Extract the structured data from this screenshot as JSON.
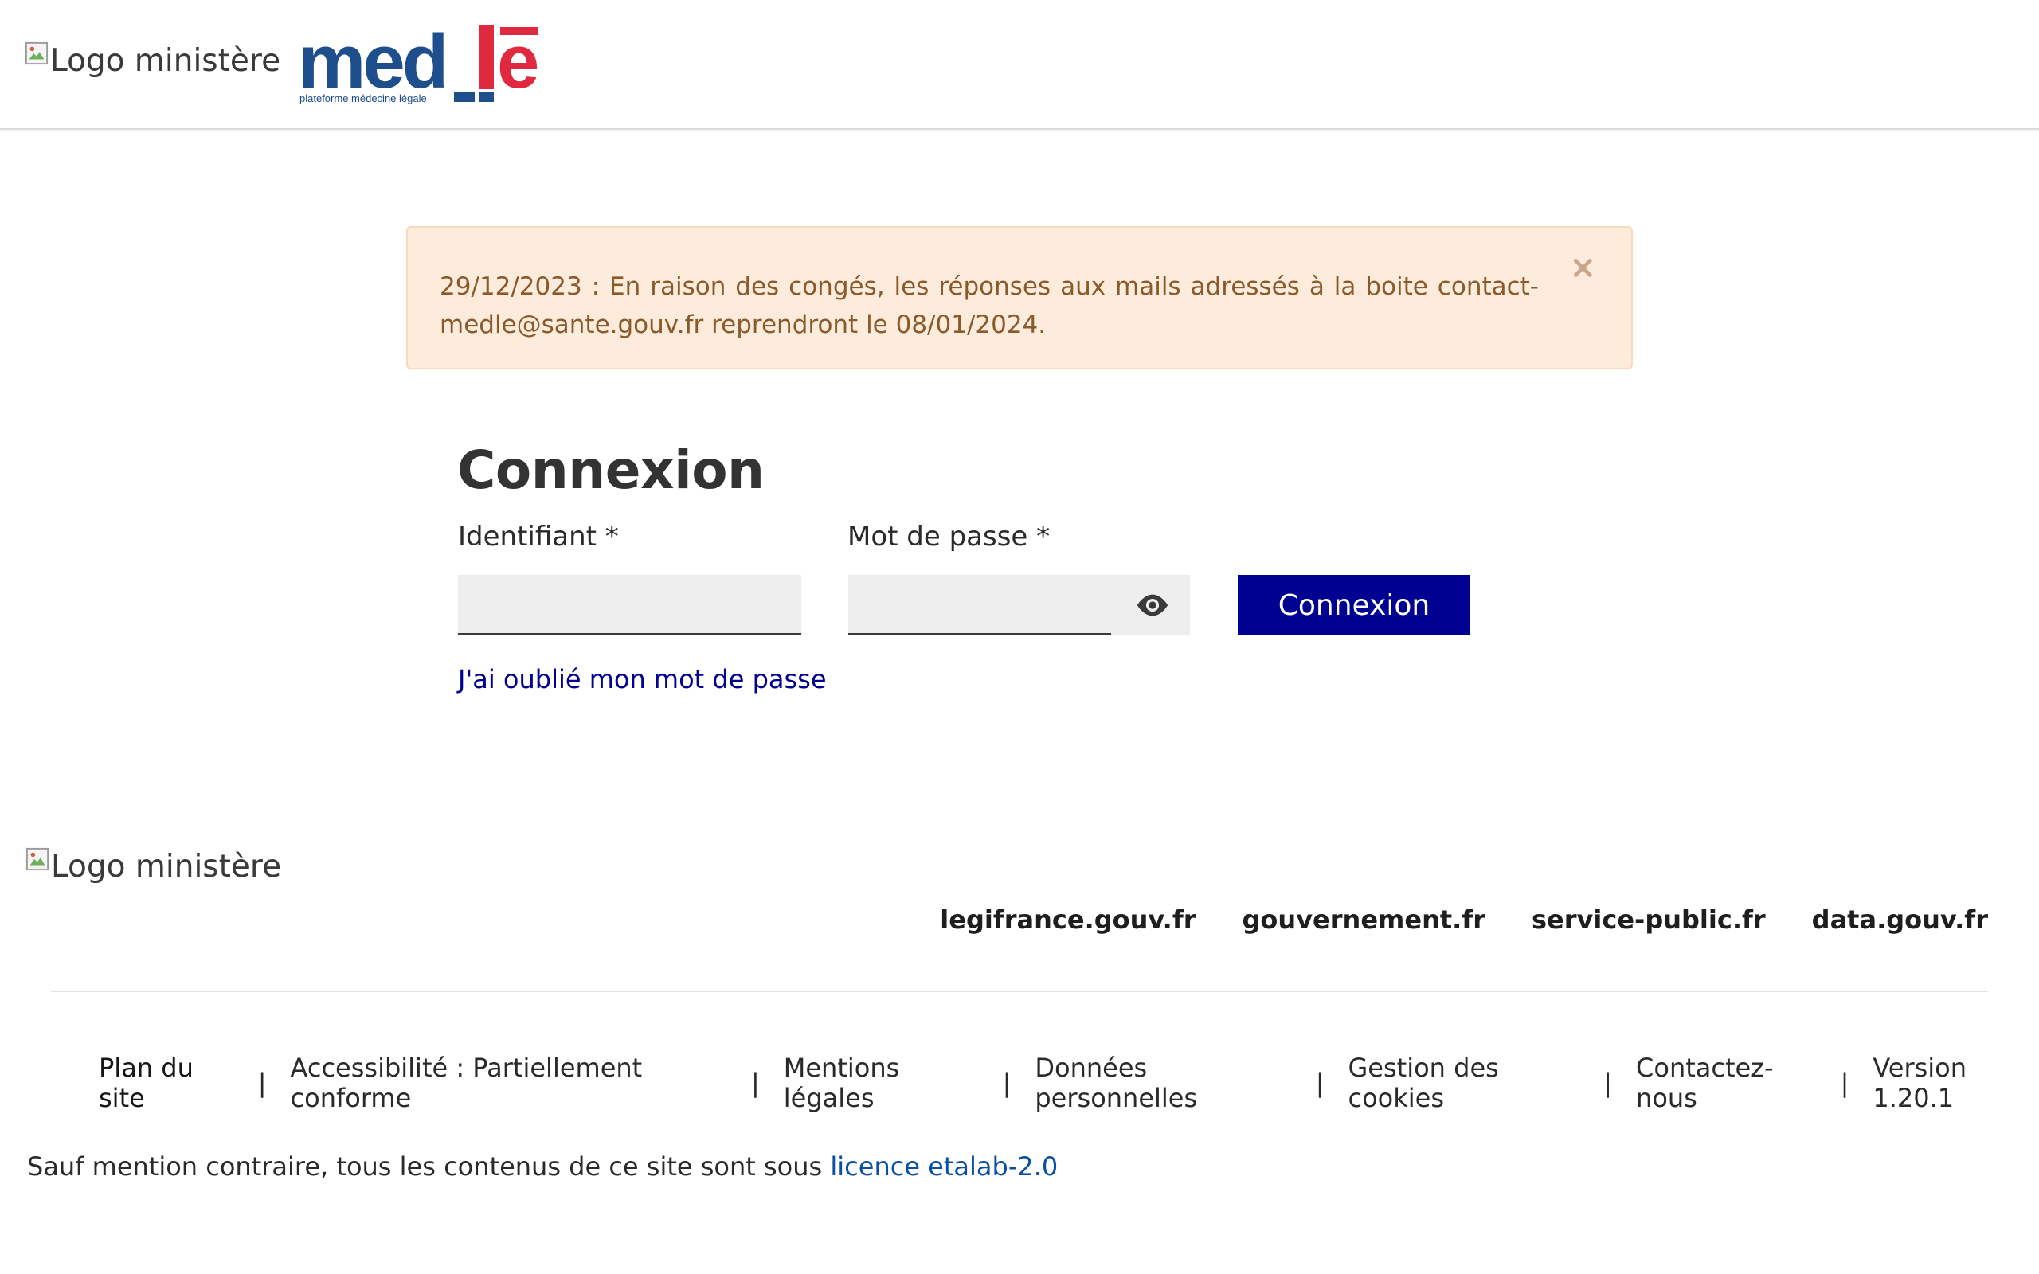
{
  "header": {
    "ministry_logo_alt": "Logo ministère",
    "brand": {
      "name": "medlē",
      "tagline": "plateforme médecine légale",
      "colors": {
        "blue": "#1f4e8c",
        "red": "#e0283f"
      }
    }
  },
  "alert": {
    "message": "29/12/2023 : En raison des congés, les réponses aux mails adressés à la boite contact-medle@sante.gouv.fr reprendront le 08/01/2024.",
    "close_symbol": "×"
  },
  "login": {
    "title": "Connexion",
    "username_label": "Identifiant *",
    "username_value": "",
    "password_label": "Mot de passe *",
    "password_value": "",
    "show_password_icon": "eye-icon",
    "submit_label": "Connexion",
    "forgot_link": "J'ai oublié mon mot de passe"
  },
  "footer": {
    "ministry_logo_alt": "Logo ministère",
    "partner_links": [
      "legifrance.gouv.fr",
      "gouvernement.fr",
      "service-public.fr",
      "data.gouv.fr"
    ],
    "bottom_links": {
      "plan": "Plan du site",
      "accessibility": "Accessibilité : Partiellement conforme",
      "legal": "Mentions légales",
      "personal_data": "Données personnelles",
      "cookies": "Gestion des cookies",
      "contact": "Contactez-nous",
      "version": "Version 1.20.1"
    },
    "separator": "|",
    "license_text": "Sauf mention contraire, tous les contenus de ce site sont sous ",
    "license_link": "licence etalab-2.0"
  },
  "colors": {
    "primary": "#000091",
    "alert_bg": "#fdebdc",
    "alert_text": "#8a5a2b",
    "link": "#0a4fa3"
  }
}
